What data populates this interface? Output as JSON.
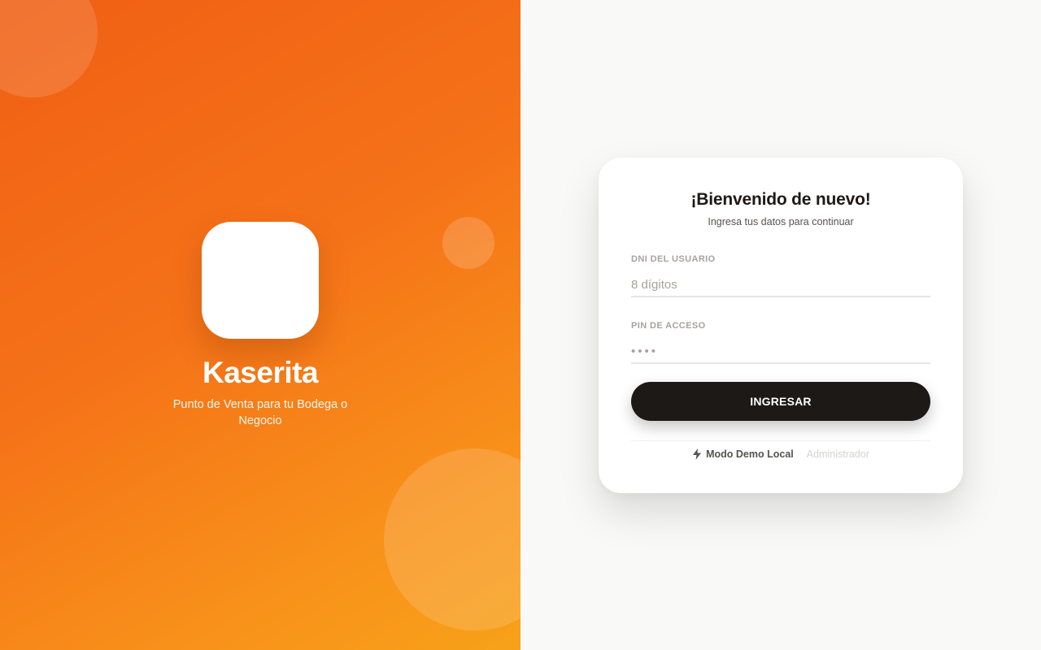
{
  "brand": {
    "name": "Kaserita",
    "tagline": "Punto de Venta para tu Bodega o Negocio"
  },
  "login": {
    "title": "¡Bienvenido de nuevo!",
    "subtitle": "Ingresa tus datos para continuar",
    "dni_label": "DNI DEL USUARIO",
    "dni_value": "",
    "dni_placeholder": "8 dígitos",
    "pin_label": "PIN DE ACCESO",
    "pin_value": "",
    "pin_placeholder": "••••",
    "submit_label": "INGRESAR",
    "demo_label": "Modo Demo Local",
    "demo_icon": "bolt-icon",
    "admin_label": "Administrador"
  },
  "colors": {
    "brand_orange": "#f57218",
    "button_dark": "#1c1917",
    "panel_bg": "#f9f9f8"
  }
}
